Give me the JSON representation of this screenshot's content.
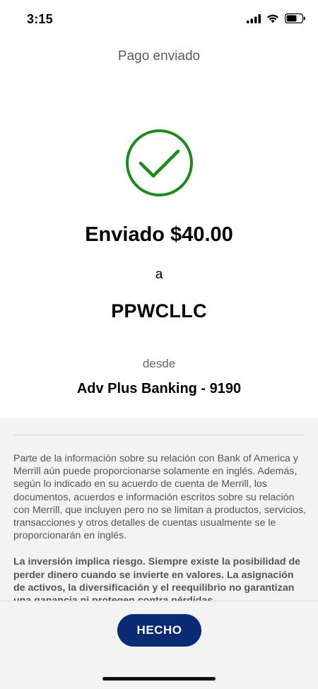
{
  "status_bar": {
    "time": "3:15",
    "icons": [
      "cellular-signal-icon",
      "wifi-icon",
      "battery-icon"
    ]
  },
  "header": {
    "title": "Pago enviado"
  },
  "confirmation": {
    "icon": "check-circle-icon",
    "icon_color": "#1e8a1e",
    "amount_line": "Enviado $40.00",
    "to_word": "a",
    "recipient": "PPWCLLC",
    "from_word": "desde",
    "account": "Adv Plus Banking - 9190"
  },
  "disclosure": {
    "paragraph_1": "Parte de la información sobre su relación con Bank of America y Merrill aún puede proporcionarse solamente en inglés. Además, según lo indicado en su acuerdo de cuenta de Merrill, los documentos, acuerdos e información escritos sobre su relación con Merrill, que incluyen pero no se limitan a productos, servicios, transacciones y otros detalles de cuentas usualmente se le proporcionarán en inglés.",
    "paragraph_2": "La inversión implica riesgo. Siempre existe la posibilidad de perder dinero cuando se invierte en valores. La asignación de activos, la diversificación y el reequilibrio no garantizan una ganancia ni protegen contra pérdidas"
  },
  "footer": {
    "done_label": "HECHO",
    "button_color": "#0a2a74"
  }
}
